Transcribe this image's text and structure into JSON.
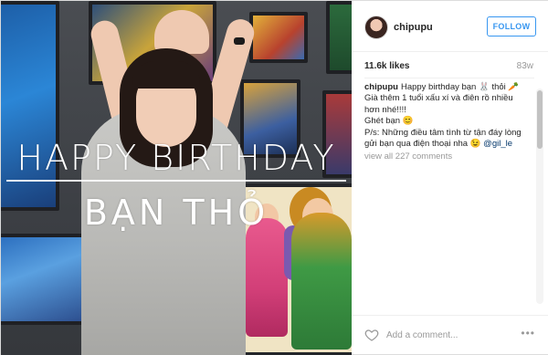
{
  "photo": {
    "overlay_line1": "HAPPY BIRTHDAY",
    "overlay_line2": "BẠN THỎ"
  },
  "header": {
    "username": "chipupu",
    "follow_label": "FOLLOW"
  },
  "meta": {
    "likes": "11.6k likes",
    "time_ago": "83w"
  },
  "caption": {
    "username": "chipupu",
    "line1": "Happy birthday bạn 🐰 thỏi 🥕",
    "line2": "Già thêm 1 tuổi xấu xí và điên rồ nhiều",
    "line3": "hơn nhé!!!!",
    "line4": "Ghét bạn 😊",
    "line5": "P/s: Những điều tâm tình từ tận đáy lòng",
    "line6_prefix": "gửi bạn qua điện thoại nha 😉",
    "mention": "@gil_le"
  },
  "comments": {
    "view_all": "view all 227 comments"
  },
  "footer": {
    "comment_placeholder": "Add a comment...",
    "more_label": "•••"
  },
  "icons": {
    "like": "heart-icon",
    "more": "more-options-icon",
    "avatar": "user-avatar"
  },
  "colors": {
    "accent": "#3897f0",
    "mention": "#003569",
    "muted": "#999999"
  }
}
